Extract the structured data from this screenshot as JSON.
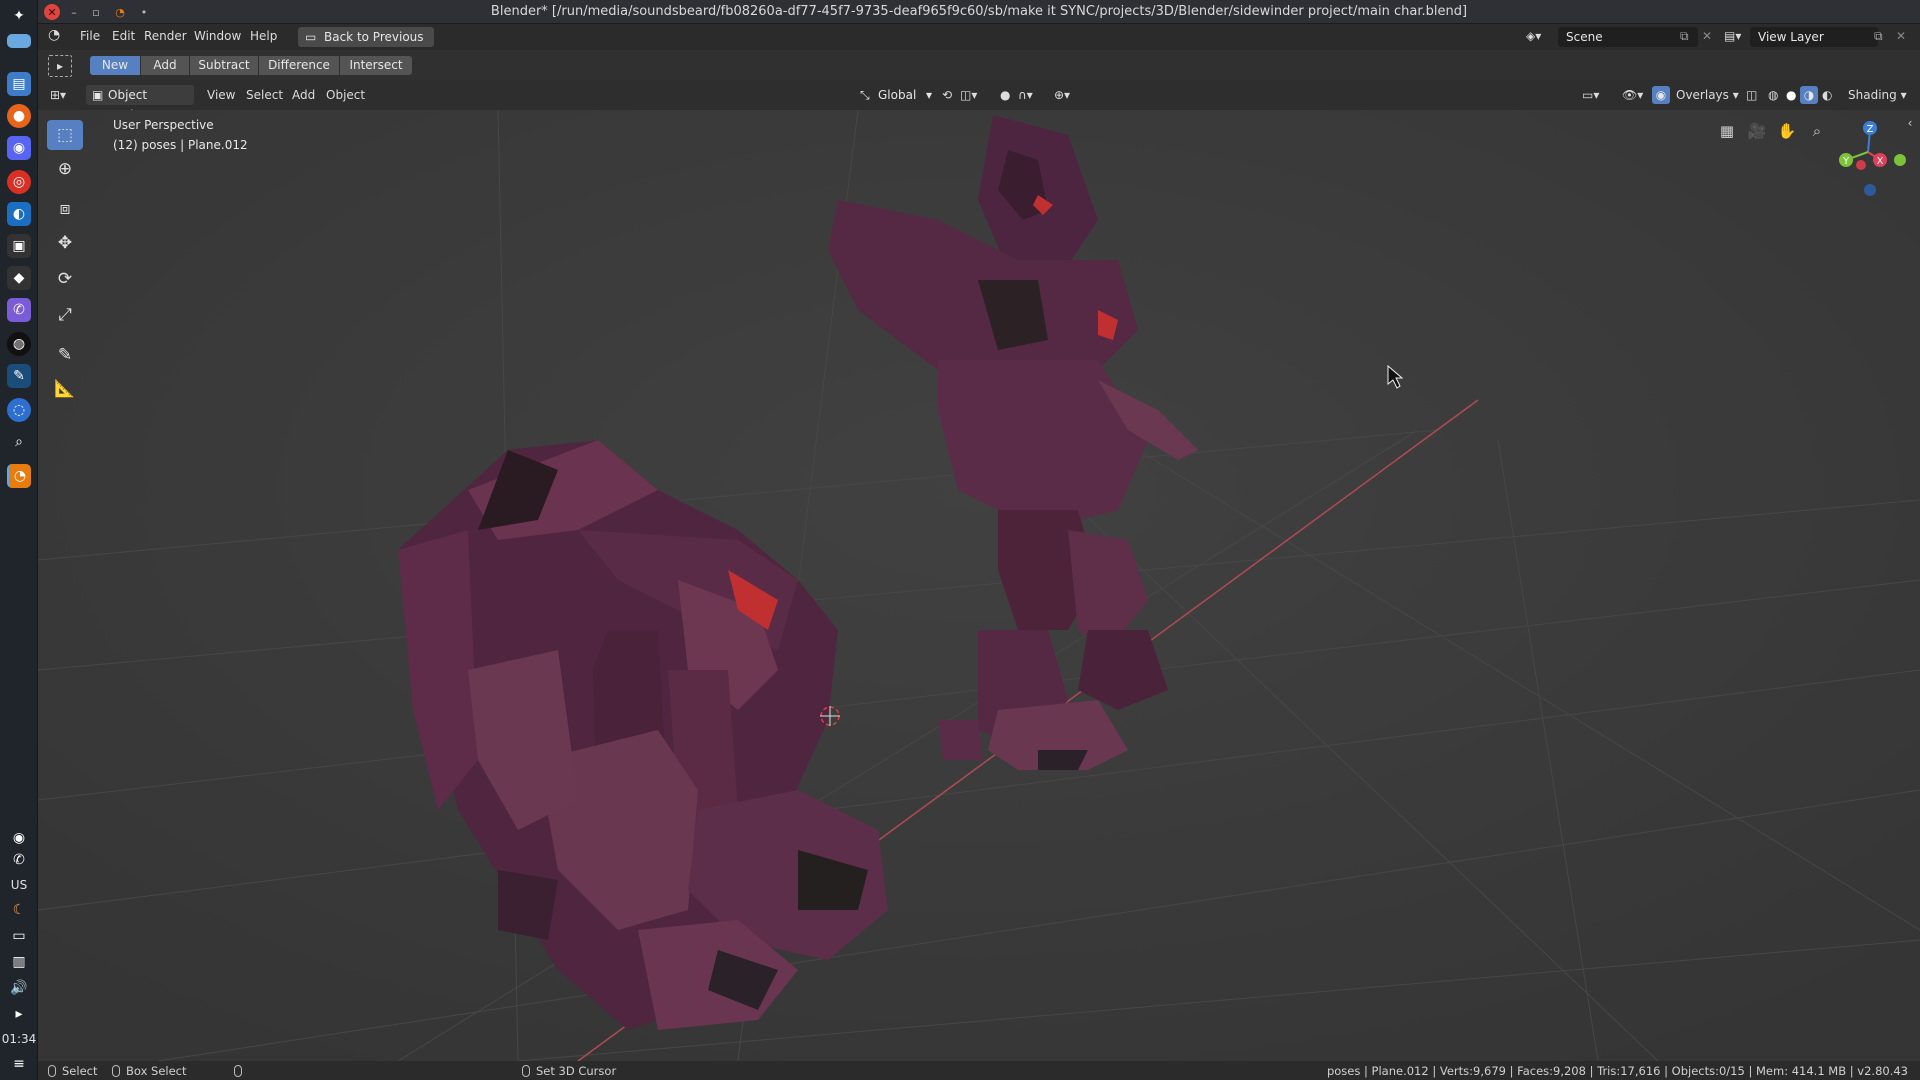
{
  "window": {
    "title": "Blender* [/run/media/soundsbeard/fb08260a-df77-45f7-9735-deaf965f9c60/sb/make it SYNC/projects/3D/Blender/sidewinder project/main char.blend]"
  },
  "menubar": {
    "items": [
      "File",
      "Edit",
      "Render",
      "Window",
      "Help"
    ],
    "back_button": "Back to Previous",
    "scene": "Scene",
    "view_layer": "View Layer"
  },
  "tool_header": {
    "boolean_ops": [
      "New",
      "Add",
      "Subtract",
      "Difference",
      "Intersect"
    ],
    "active": "New"
  },
  "viewport_header": {
    "mode": "Object Mode",
    "menus": [
      "View",
      "Select",
      "Add",
      "Object"
    ],
    "transform_orientation": "Global",
    "overlays": "Overlays",
    "shading": "Shading"
  },
  "viewport": {
    "perspective": "User Perspective",
    "object_info": "(12) poses | Plane.012",
    "gizmo_axes": [
      "Z",
      "X",
      "Y"
    ]
  },
  "statusbar": {
    "select": "Select",
    "box_select": "Box Select",
    "set_cursor": "Set 3D Cursor",
    "stats": "poses | Plane.012 | Verts:9,679 | Faces:9,208 | Tris:17,616 | Objects:0/15 | Mem: 414.1 MB | v2.80.43"
  },
  "dock": {
    "keyboard_layout": "US",
    "clock": "01:34"
  },
  "colors": {
    "active_blue": "#5680c2",
    "viewport_bg": "#3b3b3b",
    "robot_purple": "#5a2a45",
    "axis_red": "#e0405a",
    "axis_green": "#7cc33a",
    "axis_blue": "#3b7fd6"
  }
}
